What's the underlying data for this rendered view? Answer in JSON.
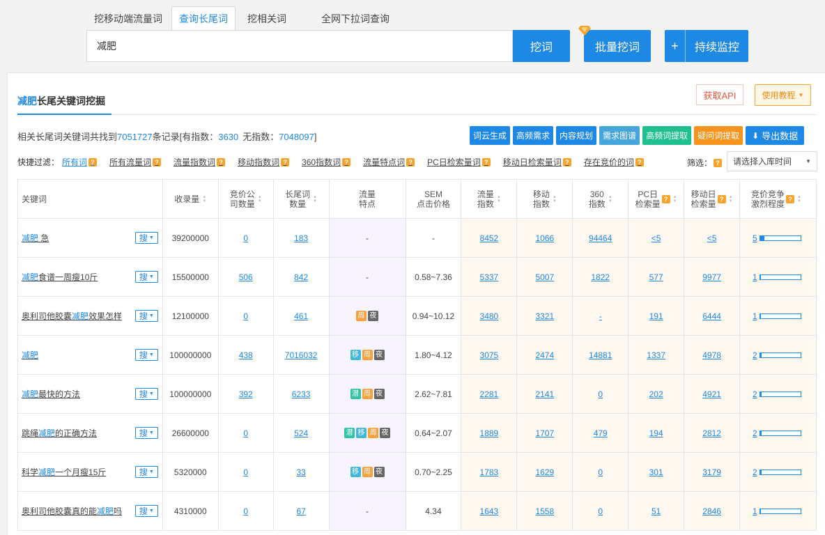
{
  "tabs": [
    "挖移动端流量词",
    "查询长尾词",
    "挖相关词",
    "全网下拉词查询"
  ],
  "search": {
    "value": "减肥"
  },
  "buttons": {
    "wa": "挖词",
    "batch": "批量挖词",
    "monitor_plus": "+",
    "monitor": "持续监控"
  },
  "card": {
    "title_kw": "减肥",
    "title_rest": "长尾关键词挖掘",
    "api": "获取API",
    "tutorial": "使用教程"
  },
  "summary": {
    "prefix": "相关长尾词关键词共找到",
    "total": "7051727",
    "mid1": "条记录[有指数：",
    "with_index": "3630",
    "mid2": "无指数：",
    "no_index": "7048097",
    "suffix": "]"
  },
  "tools": [
    "词云生成",
    "高频需求",
    "内容规划",
    "需求图谱",
    "高频词提取",
    "疑问词提取",
    "导出数据"
  ],
  "filter": {
    "label": "快捷过滤：",
    "items": [
      "所有词",
      "所有流量词",
      "流量指数词",
      "移动指数词",
      "360指数词",
      "流量特点词",
      "PC日检索量词",
      "移动日检索量词",
      "存在竞价的词"
    ],
    "screen_label": "筛选：",
    "select_placeholder": "请选择入库时间"
  },
  "table": {
    "headers": {
      "kw": "关键词",
      "num": "收录量",
      "bid": [
        "竞价公",
        "司数量"
      ],
      "long": [
        "长尾词",
        "数量"
      ],
      "feat": [
        "流量",
        "特点"
      ],
      "sem": [
        "SEM",
        "点击价格"
      ],
      "flow": [
        "流量",
        "指数"
      ],
      "mobile": [
        "移动",
        "指数"
      ],
      "i360": [
        "360",
        "指数"
      ],
      "pc": [
        "PC日",
        "检索量"
      ],
      "mday": [
        "移动日",
        "检索量"
      ],
      "comp": [
        "竞价竞争",
        "激烈程度"
      ]
    },
    "search_btn": "搜",
    "rows": [
      {
        "pre": "",
        "hl": "减肥",
        "post": " 急",
        "num": "39200000",
        "bid": "0",
        "long": "183",
        "tags": [],
        "feat": "-",
        "sem": "-",
        "flow": "8452",
        "mobile": "1066",
        "i360": "94464",
        "pc": "<5",
        "mday": "<5",
        "comp": "5",
        "comp_level": 0.1
      },
      {
        "pre": "",
        "hl": "减肥",
        "post": "食谱一周瘦10斤",
        "num": "15500000",
        "bid": "506",
        "long": "842",
        "tags": [],
        "feat": "-",
        "sem": "0.58~7.36",
        "flow": "5337",
        "mobile": "5007",
        "i360": "1822",
        "pc": "577",
        "mday": "9977",
        "comp": "1",
        "comp_level": 0.02
      },
      {
        "pre": "奥利司他胶囊",
        "hl": "减肥",
        "post": "效果怎样",
        "num": "12100000",
        "bid": "0",
        "long": "461",
        "tags": [
          "周",
          "夜"
        ],
        "feat": "",
        "sem": "0.94~10.12",
        "flow": "3480",
        "mobile": "3321",
        "i360": "-",
        "pc": "191",
        "mday": "6444",
        "comp": "1",
        "comp_level": 0.02
      },
      {
        "pre": "",
        "hl": "减肥",
        "post": "",
        "num": "100000000",
        "bid": "438",
        "long": "7016032",
        "tags": [
          "移",
          "周",
          "夜"
        ],
        "feat": "",
        "sem": "1.80~4.12",
        "flow": "3075",
        "mobile": "2474",
        "i360": "14881",
        "pc": "1337",
        "mday": "4978",
        "comp": "2",
        "comp_level": 0.04
      },
      {
        "pre": "",
        "hl": "减肥",
        "post": "最快的方法",
        "num": "100000000",
        "bid": "392",
        "long": "6233",
        "tags": [
          "潜",
          "周",
          "夜"
        ],
        "feat": "",
        "sem": "2.62~7.81",
        "flow": "2281",
        "mobile": "2141",
        "i360": "0",
        "pc": "202",
        "mday": "4921",
        "comp": "2",
        "comp_level": 0.04
      },
      {
        "pre": "跳绳",
        "hl": "减肥",
        "post": "的正确方法",
        "num": "26600000",
        "bid": "0",
        "long": "524",
        "tags": [
          "潜",
          "移",
          "周",
          "夜"
        ],
        "feat": "",
        "sem": "0.64~2.07",
        "flow": "1889",
        "mobile": "1707",
        "i360": "479",
        "pc": "194",
        "mday": "2812",
        "comp": "2",
        "comp_level": 0.04
      },
      {
        "pre": "科学",
        "hl": "减肥",
        "post": "一个月瘦15斤",
        "num": "5320000",
        "bid": "0",
        "long": "33",
        "tags": [
          "移",
          "周",
          "夜"
        ],
        "feat": "",
        "sem": "0.70~2.25",
        "flow": "1783",
        "mobile": "1629",
        "i360": "0",
        "pc": "301",
        "mday": "3179",
        "comp": "2",
        "comp_level": 0.04
      },
      {
        "pre": "奥利司他胶囊真的能",
        "hl": "减肥",
        "post": "吗",
        "num": "4310000",
        "bid": "0",
        "long": "67",
        "tags": [],
        "feat": "-",
        "sem": "4.34",
        "flow": "1643",
        "mobile": "1558",
        "i360": "0",
        "pc": "51",
        "mday": "2846",
        "comp": "1",
        "comp_level": 0.02
      }
    ]
  },
  "colors": {
    "accent": "#1e88e5",
    "orange": "#f7941d",
    "green": "#1fbf8f"
  }
}
